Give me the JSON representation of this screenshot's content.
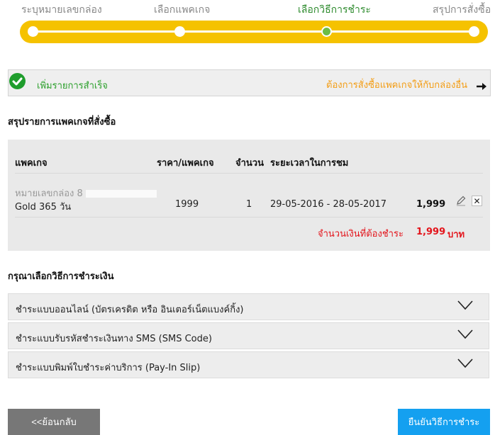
{
  "stepper": {
    "steps": [
      {
        "label": "ระบุหมายเลขกล่อง",
        "state": "done"
      },
      {
        "label": "เลือกแพคเกจ",
        "state": "done"
      },
      {
        "label": "เลือกวิธีการชำระ",
        "state": "active"
      },
      {
        "label": "สรุปการสั่งซื้อ",
        "state": "pending"
      }
    ],
    "colors": {
      "bar": "#f5c200",
      "active_dot": "#6dbd45",
      "active_label": "#2e8b2e"
    }
  },
  "success_bar": {
    "icon": "check-circle-icon",
    "message": "เพิ่มรายการสำเร็จ",
    "other_link": "ต้องการสั่งซื้อแพคเกจให้กับกล่องอื่น",
    "arrow_icon": "arrow-right-icon"
  },
  "summary": {
    "title": "สรุปรายการแพคเกจที่สั่งซื้อ",
    "headers": {
      "package": "แพคเกจ",
      "price": "ราคา/แพคเกจ",
      "qty": "จำนวน",
      "period": "ระยะเวลาในการชม"
    },
    "row": {
      "box_label": "หมายเลขกล่อง 8",
      "package": "Gold 365 วัน",
      "price": "1999",
      "qty": "1",
      "period": "29-05-2016 - 28-05-2017",
      "total": "1,999",
      "edit_icon": "pencil-icon",
      "delete_icon": "close-icon",
      "delete_glyph": "✕"
    },
    "amount_due_label": "จำนวนเงินที่ต้องชำระ",
    "amount_due_value": "1,999",
    "currency": "บาท"
  },
  "payment": {
    "title": "กรุณาเลือกวิธีการชำระเงิน",
    "methods": [
      {
        "label": "ชำระแบบออนไลน์ (บัตรเครดิต หรือ อินเตอร์เน็ตแบงค์กิ้ง)",
        "icon": "chevron-down-icon"
      },
      {
        "label": "ชำระแบบรับรหัสชำระเงินทาง SMS (SMS Code)",
        "icon": "chevron-down-icon"
      },
      {
        "label": "ชำระแบบพิมพ์ใบชำระค่าบริการ (Pay-In Slip)",
        "icon": "chevron-down-icon"
      }
    ]
  },
  "footer": {
    "back_label": "<<ย้อนกลับ",
    "confirm_label": "ยืนยันวิธีการชำระ"
  },
  "colors": {
    "accent_yellow": "#f5c200",
    "success_green": "#2ca02c",
    "link_orange": "#f39c12",
    "amount_red": "#e3141b",
    "confirm_blue": "#14a0f0",
    "back_gray": "#777777"
  }
}
